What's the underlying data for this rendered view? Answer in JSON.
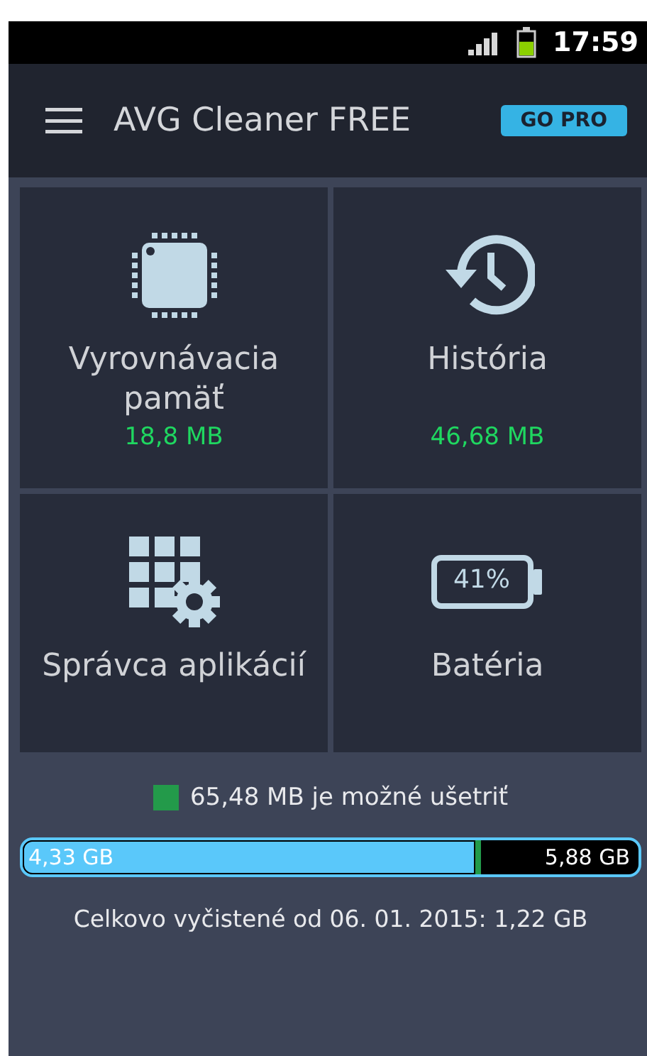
{
  "status_bar": {
    "time": "17:59",
    "battery": {
      "level": 0.6
    }
  },
  "app_bar": {
    "title": "AVG Cleaner FREE",
    "pro_button": "GO PRO"
  },
  "tiles": [
    {
      "kind": "chip",
      "title": "Vyrovnávacia pamäť",
      "value": "18,8 MB"
    },
    {
      "kind": "history",
      "title": "História",
      "value": "46,68 MB"
    },
    {
      "kind": "apps",
      "title": "Správca aplikácií"
    },
    {
      "kind": "battery",
      "title": "Batéria"
    }
  ],
  "battery_tile_icon": {
    "reading": "41%"
  },
  "savings": {
    "text": "65,48 MB je možné ušetriť",
    "color": "#239a4a"
  },
  "storage": {
    "used": "4,33 GB",
    "free": "5,88 GB",
    "level": 0.735,
    "saveable": {
      "level": 0.01
    }
  },
  "total_cleaned": "Celkovo vyčistené od 06. 01. 2015: 1,22 GB"
}
